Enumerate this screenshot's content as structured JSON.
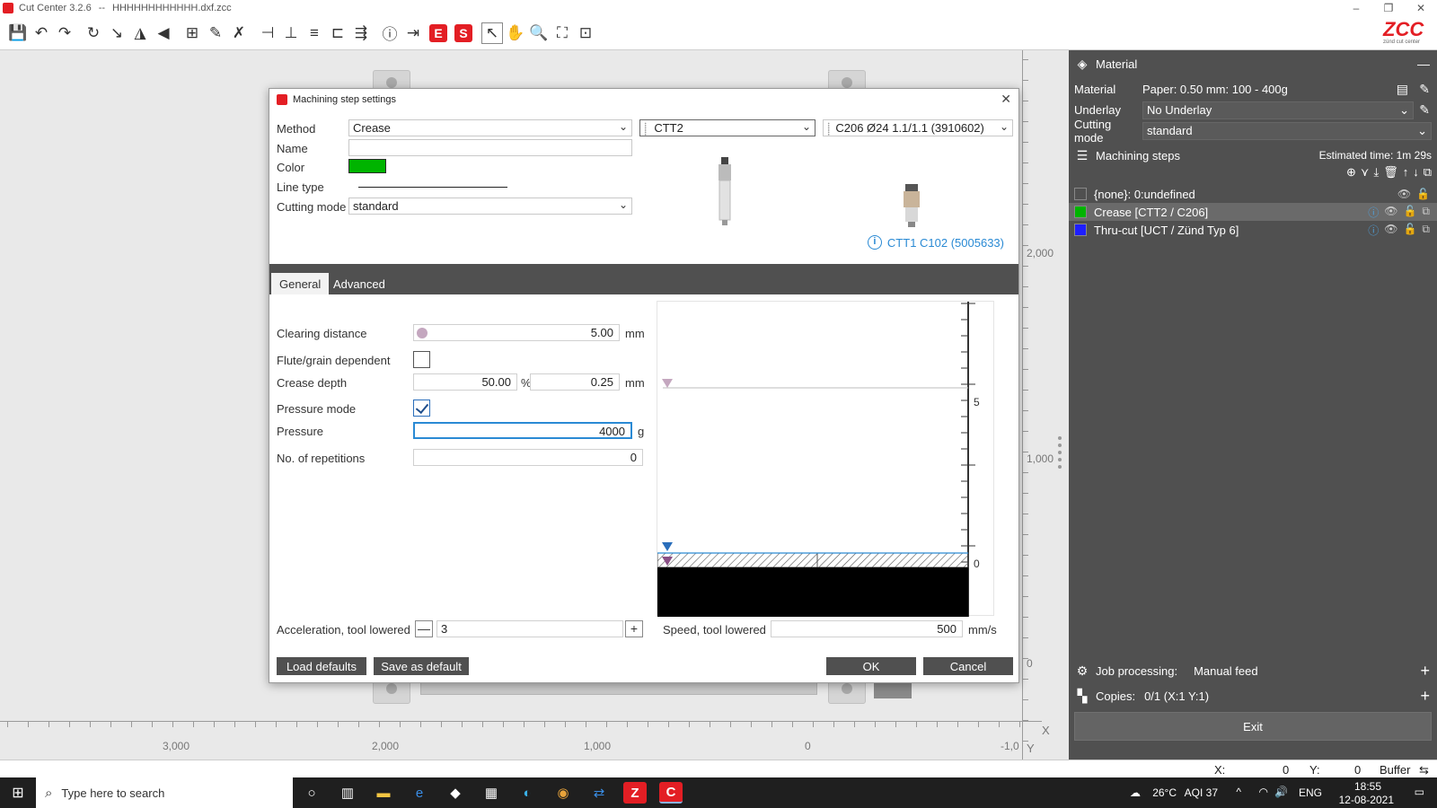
{
  "window": {
    "title": "Cut Center 3.2.6",
    "separator": "--",
    "file": "HHHHHHHHHHHH.dxf.zcc",
    "min": "–",
    "restore": "❐",
    "close": "✕"
  },
  "logo": {
    "mark": "ZCC",
    "tagline": "zünd cut center"
  },
  "canvas": {
    "vruler": [
      "2,000",
      "1,000",
      "0"
    ],
    "hruler": [
      "3,000",
      "2,000",
      "1,000",
      "0",
      "-1,0"
    ],
    "x_axis": "X",
    "y_axis": "Y"
  },
  "dialog": {
    "title": "Machining step settings",
    "close": "✕",
    "method_label": "Method",
    "method_value": "Crease",
    "tool_value": "CTT2",
    "insert_value": "C206 Ø24 1.1/1.1 (3910602)",
    "name_label": "Name",
    "name_value": "",
    "color_label": "Color",
    "color_value": "#00b400",
    "linetype_label": "Line type",
    "cutting_mode_label": "Cutting mode",
    "cutting_mode_value": "standard",
    "ctt1_info": "CTT1 C102 (5005633)",
    "tabs": [
      "General",
      "Advanced"
    ],
    "general": {
      "clearing_label": "Clearing distance",
      "clearing_value": "5.00",
      "clearing_unit": "mm",
      "flute_label": "Flute/grain dependent",
      "flute_checked": false,
      "crease_label": "Crease depth",
      "crease_percent": "50.00",
      "crease_percent_unit": "%",
      "crease_mm": "0.25",
      "crease_mm_unit": "mm",
      "pressure_mode_label": "Pressure mode",
      "pressure_mode_checked": true,
      "pressure_label": "Pressure",
      "pressure_value": "4000",
      "pressure_unit": "g",
      "repetitions_label": "No. of repetitions",
      "repetitions_value": "0",
      "accel_label": "Acceleration, tool lowered",
      "accel_value": "3",
      "speed_label": "Speed, tool lowered",
      "speed_value": "500",
      "speed_unit": "mm/s"
    },
    "preview": {
      "tick_5": "5",
      "tick_0": "0"
    },
    "buttons": {
      "load_defaults": "Load defaults",
      "save_default": "Save as default",
      "ok": "OK",
      "cancel": "Cancel"
    }
  },
  "panel": {
    "material_header": "Material",
    "material_label": "Material",
    "material_value": "Paper: 0.50 mm: 100 - 400g",
    "underlay_label": "Underlay",
    "underlay_value": "No Underlay",
    "cutting_mode_label": "Cutting mode",
    "cutting_mode_value": "standard",
    "steps_header": "Machining steps",
    "estimated_time": "Estimated time: 1m 29s",
    "steps": [
      {
        "label": "{none}: 0:undefined",
        "color": "#505050"
      },
      {
        "label": "Crease [CTT2 / C206]",
        "color": "#00b400"
      },
      {
        "label": "Thru-cut [UCT / Zünd Typ 6]",
        "color": "#1e1eff"
      }
    ],
    "job_label": "Job processing:",
    "job_value": "Manual feed",
    "copies_label": "Copies:",
    "copies_value": "0/1 (X:1 Y:1)",
    "exit": "Exit"
  },
  "status": {
    "x_label": "X:",
    "x_value": "0",
    "y_label": "Y:",
    "y_value": "0",
    "buffer": "Buffer"
  },
  "taskbar": {
    "search_placeholder": "Type here to search",
    "weather": "26°C",
    "aqi": "AQI 37",
    "lang": "ENG",
    "time": "18:55",
    "date": "12-08-2021"
  }
}
